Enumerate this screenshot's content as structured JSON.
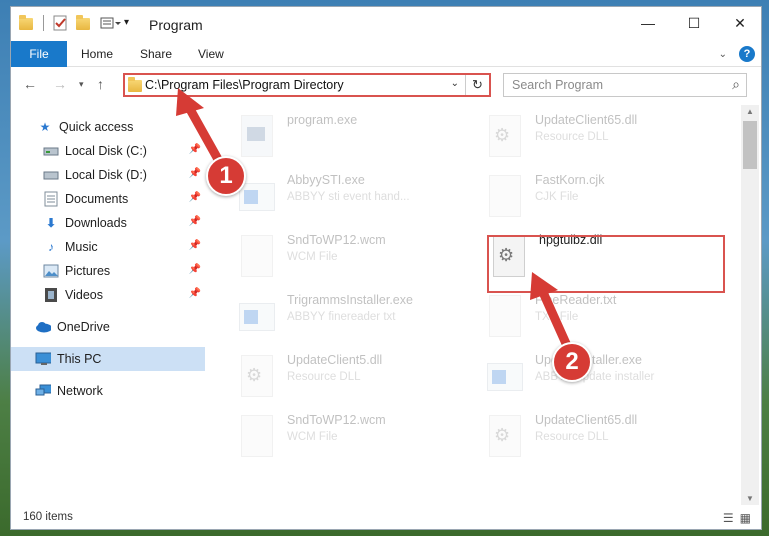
{
  "window": {
    "title": "Program",
    "controls": {
      "minimize": "—",
      "maximize": "☐",
      "close": "✕"
    }
  },
  "ribbon": {
    "tabs": [
      "File",
      "Home",
      "Share",
      "View"
    ],
    "help": "?"
  },
  "navbar": {
    "address": "C:\\Program Files\\Program Directory",
    "search_placeholder": "Search Program"
  },
  "sidebar": {
    "items": [
      {
        "label": "Quick access",
        "icon": "star-icon"
      },
      {
        "label": "Local Disk (C:)",
        "icon": "drive-icon",
        "pinned": true
      },
      {
        "label": "Local Disk (D:)",
        "icon": "drive-icon",
        "pinned": true
      },
      {
        "label": "Documents",
        "icon": "documents-icon",
        "pinned": true
      },
      {
        "label": "Downloads",
        "icon": "download-icon",
        "pinned": true
      },
      {
        "label": "Music",
        "icon": "music-icon",
        "pinned": true
      },
      {
        "label": "Pictures",
        "icon": "pictures-icon",
        "pinned": true
      },
      {
        "label": "Videos",
        "icon": "videos-icon",
        "pinned": true
      },
      {
        "label": "OneDrive",
        "icon": "cloud-icon"
      },
      {
        "label": "This PC",
        "icon": "computer-icon",
        "selected": true
      },
      {
        "label": "Network",
        "icon": "network-icon"
      }
    ]
  },
  "files": [
    {
      "name": "program.exe",
      "sub": "",
      "type": "exe"
    },
    {
      "name": "UpdateClient65.dll",
      "sub": "Resource DLL",
      "type": "dll"
    },
    {
      "name": "AbbyySTI.exe",
      "sub": "ABBYY sti event hand...",
      "type": "screen"
    },
    {
      "name": "FastKorn.cjk",
      "sub": "CJK File",
      "type": "doc"
    },
    {
      "name": "SndToWP12.wcm",
      "sub": "WCM File",
      "type": "doc"
    },
    {
      "name": "hpgtulbz.dll",
      "sub": "",
      "type": "dll",
      "highlighted": true
    },
    {
      "name": "TrigrammsInstaller.exe",
      "sub": "ABBYY finereader txt",
      "type": "screen"
    },
    {
      "name": "FineReader.txt",
      "sub": "TXT File",
      "type": "doc"
    },
    {
      "name": "UpdateClient5.dll",
      "sub": "Resource DLL",
      "type": "dll"
    },
    {
      "name": "UpdateInstaller.exe",
      "sub": "ABBYY update installer",
      "type": "screen"
    },
    {
      "name": "SndToWP12.wcm",
      "sub": "WCM File",
      "type": "doc"
    },
    {
      "name": "UpdateClient65.dll",
      "sub": "Resource DLL",
      "type": "dll"
    }
  ],
  "status": {
    "item_count": "160 items"
  },
  "annotations": {
    "badge1": "1",
    "badge2": "2",
    "color": "#d63b35"
  }
}
